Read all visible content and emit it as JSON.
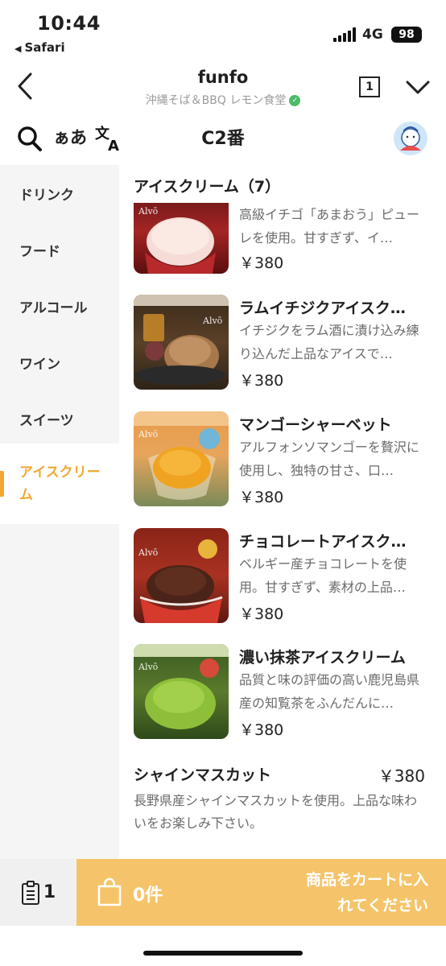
{
  "status_bar": {
    "time": "10:44",
    "back_app": "Safari",
    "network": "4G",
    "battery": "98"
  },
  "header": {
    "title": "funfo",
    "subtitle": "沖縄そば＆BBQ レモン食堂",
    "tab_count": "1",
    "table_label": "C2番",
    "font_toggle": "ぁあ"
  },
  "sidebar": {
    "items": [
      {
        "label": "ドリンク"
      },
      {
        "label": "フード"
      },
      {
        "label": "アルコール"
      },
      {
        "label": "ワイン"
      },
      {
        "label": "スイーツ"
      },
      {
        "label": "アイスクリー\nム",
        "active": true
      }
    ]
  },
  "menu": {
    "section_title": "アイスクリーム（7）",
    "items": [
      {
        "name": "",
        "desc": "高級イチゴ「あまおう」ピューレを使用。甘すぎず、イ…",
        "price": "￥380",
        "image": "strawberry-ice-cream"
      },
      {
        "name": "ラムイチジクアイスク…",
        "desc": "イチジクをラム酒に漬け込み練り込んだ上品なアイスで…",
        "price": "￥380",
        "image": "rum-fig-ice-cream"
      },
      {
        "name": "マンゴーシャーベット",
        "desc": "アルフォンソマンゴーを贅沢に使用し、独特の甘さ、口…",
        "price": "￥380",
        "image": "mango-sherbet"
      },
      {
        "name": "チョコレートアイスク…",
        "desc": "ベルギー産チョコレートを使用。甘すぎず、素材の上品…",
        "price": "￥380",
        "image": "chocolate-ice-cream"
      },
      {
        "name": "濃い抹茶アイスクリーム",
        "desc": "品質と味の評価の高い鹿児島県産の知覧茶をふんだんに…",
        "price": "￥380",
        "image": "matcha-ice-cream"
      }
    ],
    "brand": "Alvō",
    "plain_item": {
      "name": "シャインマスカット",
      "price": "￥380",
      "desc": "長野県産シャインマスカットを使用。上品な味わいをお楽しみ下さい。"
    }
  },
  "bottom_bar": {
    "order_count": "1",
    "cart_count": "0件",
    "cart_message": "商品をカートに入れてください"
  },
  "colors": {
    "accent": "#f2a632",
    "cart_bar": "#f5c46a",
    "sidebar_bg": "#f5f5f5"
  }
}
